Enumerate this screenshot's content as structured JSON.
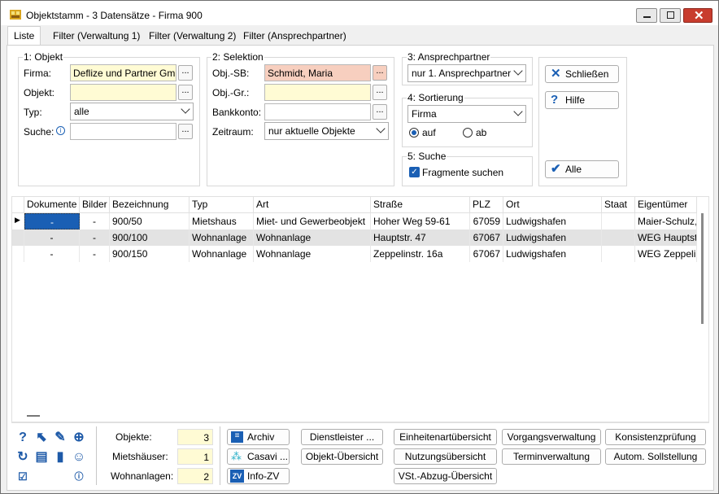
{
  "window": {
    "title": "Objektstamm - 3 Datensätze - Firma 900"
  },
  "tabs": [
    {
      "label": "Liste"
    },
    {
      "label": "Filter (Verwaltung 1)"
    },
    {
      "label": "Filter (Verwaltung 2)"
    },
    {
      "label": "Filter (Ansprechpartner)"
    }
  ],
  "objekt": {
    "group": "1: Objekt",
    "firma_label": "Firma:",
    "firma_value": "Deflize und Partner GmbH",
    "objekt_label": "Objekt:",
    "objekt_value": "",
    "typ_label": "Typ:",
    "typ_value": "alle",
    "suche_label": "Suche:",
    "suche_value": ""
  },
  "selektion": {
    "group": "2: Selektion",
    "objsb_label": "Obj.-SB:",
    "objsb_value": "Schmidt, Maria",
    "objgr_label": "Obj.-Gr.:",
    "objgr_value": "",
    "bankkonto_label": "Bankkonto:",
    "bankkonto_value": "",
    "zeitraum_label": "Zeitraum:",
    "zeitraum_value": "nur aktuelle Objekte"
  },
  "ansprechpartner": {
    "group": "3: Ansprechpartner",
    "value": "nur 1. Ansprechpartner"
  },
  "sortierung": {
    "group": "4: Sortierung",
    "value": "Firma",
    "auf_label": "auf",
    "ab_label": "ab",
    "selected": "auf"
  },
  "suche": {
    "group": "5: Suche",
    "fragmente_label": "Fragmente suchen",
    "fragmente_checked": true
  },
  "actions": {
    "close_label": "Schließen",
    "help_label": "Hilfe",
    "all_label": "Alle"
  },
  "dots": "...",
  "grid": {
    "columns": [
      "Dokumente",
      "Bilder",
      "Bezeichnung",
      "Typ",
      "Art",
      "Straße",
      "PLZ",
      "Ort",
      "Staat",
      "Eigentümer"
    ],
    "rows": [
      {
        "dokumente": "-",
        "bilder": "-",
        "bezeichnung": "900/50",
        "typ": "Mietshaus",
        "art": "Miet- und Gewerbeobjekt",
        "strasse": "Hoher Weg 59-61",
        "plz": "67059",
        "ort": "Ludwigshafen",
        "staat": "",
        "eigentuemer": "Maier-Schulz,"
      },
      {
        "dokumente": "-",
        "bilder": "-",
        "bezeichnung": "900/100",
        "typ": "Wohnanlage",
        "art": "Wohnanlage",
        "strasse": "Hauptstr. 47",
        "plz": "67067",
        "ort": "Ludwigshafen",
        "staat": "",
        "eigentuemer": "WEG Hauptstr"
      },
      {
        "dokumente": "-",
        "bilder": "-",
        "bezeichnung": "900/150",
        "typ": "Wohnanlage",
        "art": "Wohnanlage",
        "strasse": "Zeppelinstr. 16a",
        "plz": "67067",
        "ort": "Ludwigshafen",
        "staat": "",
        "eigentuemer": "WEG Zeppelin"
      }
    ]
  },
  "stats": {
    "objekte_label": "Objekte:",
    "objekte": "3",
    "mietshaeuser_label": "Mietshäuser:",
    "mietshaeuser": "1",
    "wohnanlagen_label": "Wohnanlagen:",
    "wohnanlagen": "2"
  },
  "bottom_buttons": {
    "archiv": "Archiv",
    "casavi": "Casavi ...",
    "infozv": "Info-ZV",
    "dienstleister": "Dienstleister ...",
    "objekt_uebersicht": "Objekt-Übersicht",
    "einheitenart": "Einheitenartübersicht",
    "nutzung": "Nutzungsübersicht",
    "vst": "VSt.-Abzug-Übersicht",
    "vorgang": "Vorgangsverwaltung",
    "termin": "Terminverwaltung",
    "konsistenz": "Konsistenzprüfung",
    "autom": "Autom. Sollstellung"
  },
  "colors": {
    "accent": "#1a5fb4",
    "required_yellow": "#fffbd4",
    "error_red": "#f7cfbf",
    "close_red": "#c83c2e"
  }
}
